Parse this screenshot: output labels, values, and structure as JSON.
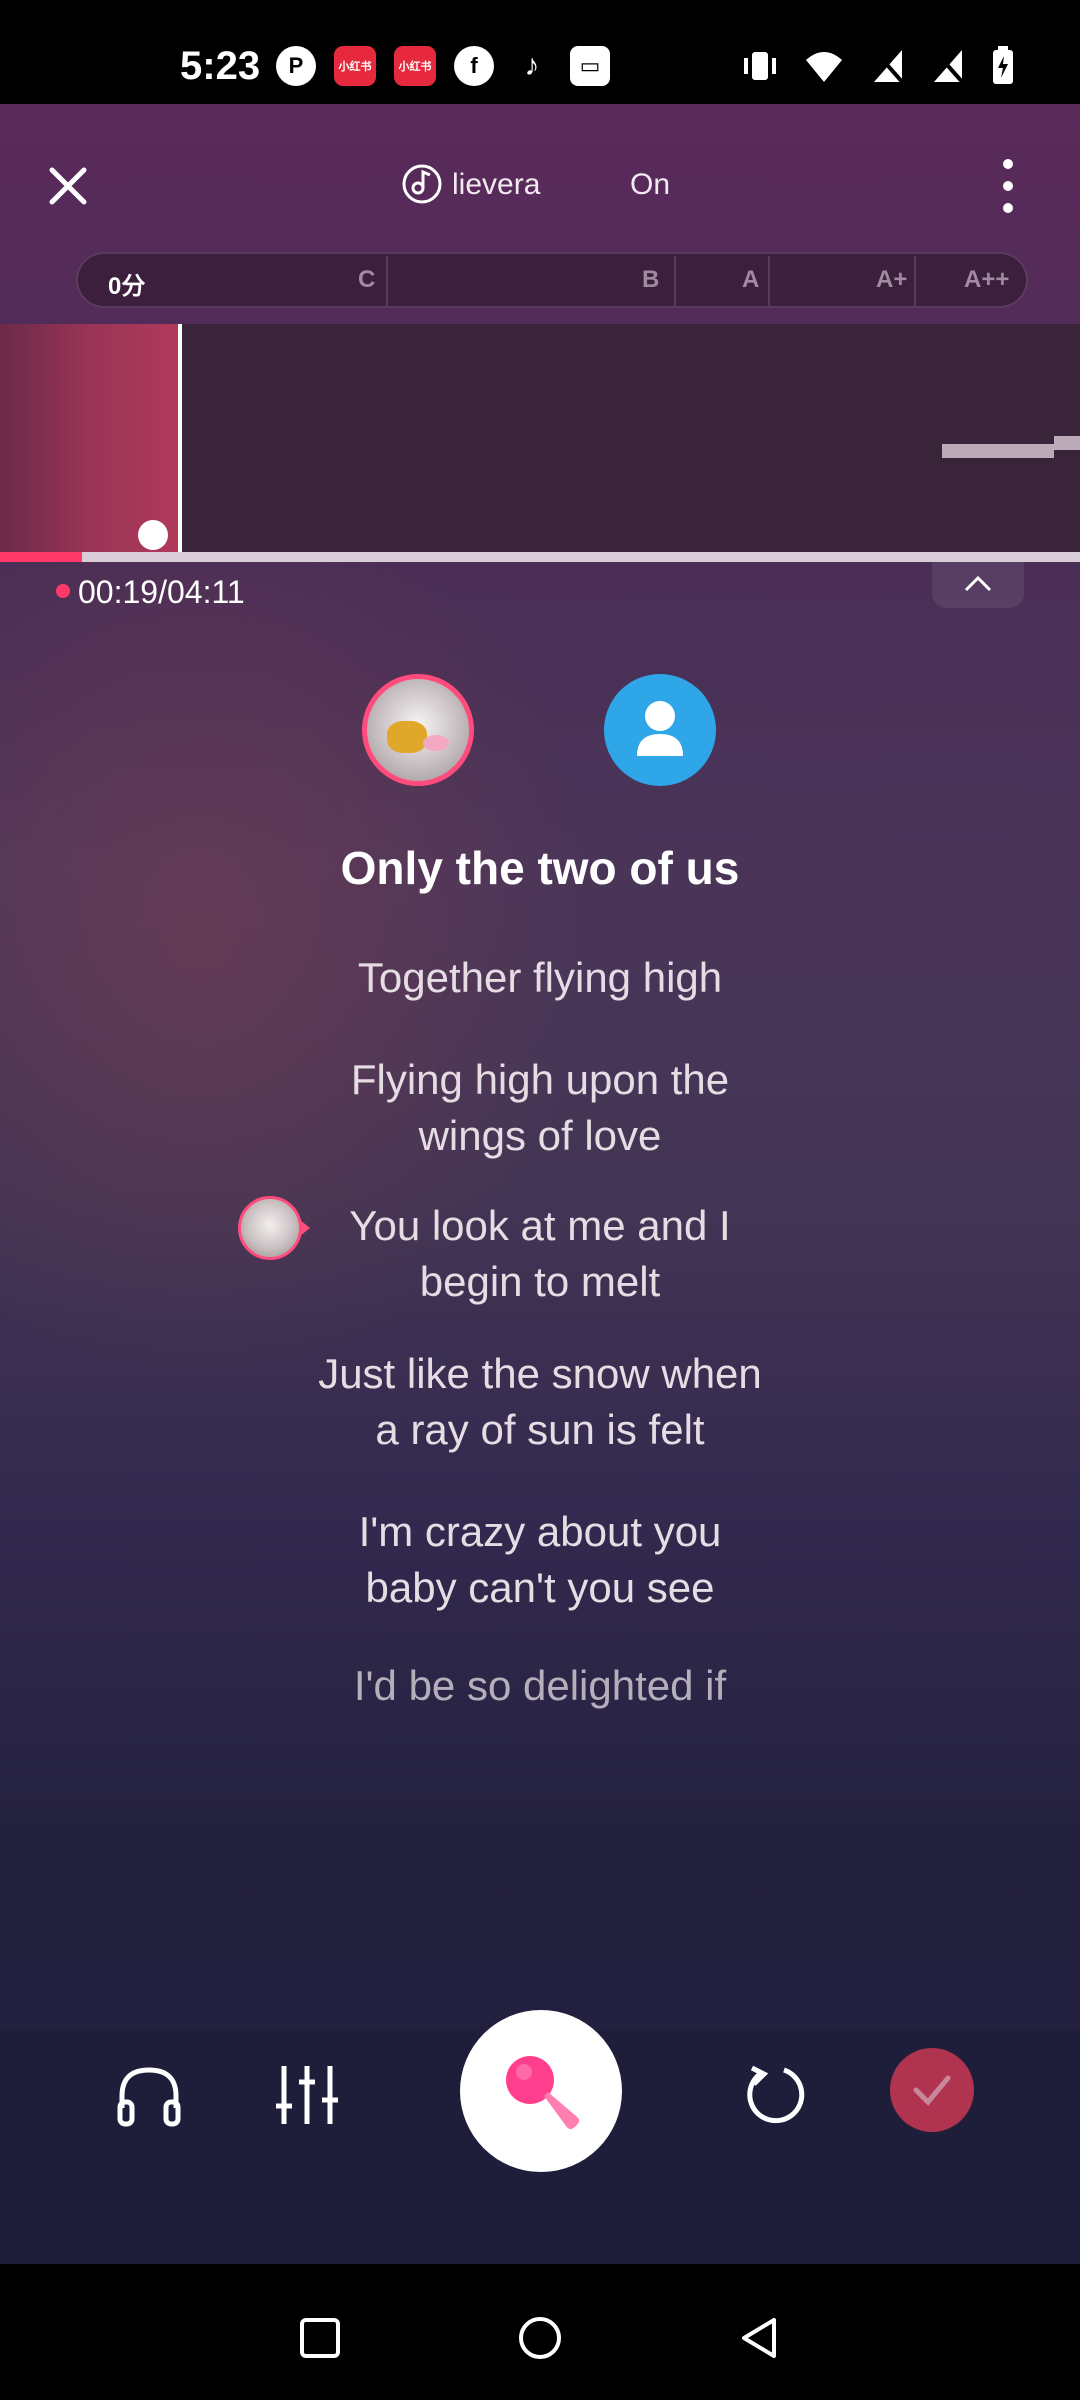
{
  "status_bar": {
    "time": "5:23",
    "app_icons": [
      "p-icon",
      "xiaohongshu-icon",
      "xiaohongshu-icon",
      "facebook-icon",
      "tiktok-icon",
      "inbox-icon"
    ],
    "xhs_label": "小红书",
    "right_icons": [
      "vibrate-icon",
      "wifi-icon",
      "no-signal-icon",
      "no-signal-icon",
      "battery-charging-icon"
    ]
  },
  "header": {
    "song_title": "lievera",
    "song_title_secondary": "On"
  },
  "score": {
    "label": "0分",
    "grades": [
      "C",
      "B",
      "A",
      "A+",
      "A++"
    ]
  },
  "playback": {
    "time": "00:19/04:11",
    "progress": 0.076
  },
  "lyrics": [
    "Only the two of us",
    "Together flying high",
    "Flying high upon the\nwings of love",
    "You look at me and I\nbegin to melt",
    "Just like the snow when\na ray of sun is felt",
    "I'm crazy about you\nbaby can't you see",
    "I'd be so delighted if"
  ],
  "colors": {
    "accent": "#ff3a6b",
    "avatar_blue": "#2fa6e8",
    "done": "#b0334f"
  },
  "controls": [
    "headphones-icon",
    "equalizer-icon",
    "microphone-icon",
    "restart-icon",
    "check-icon"
  ]
}
